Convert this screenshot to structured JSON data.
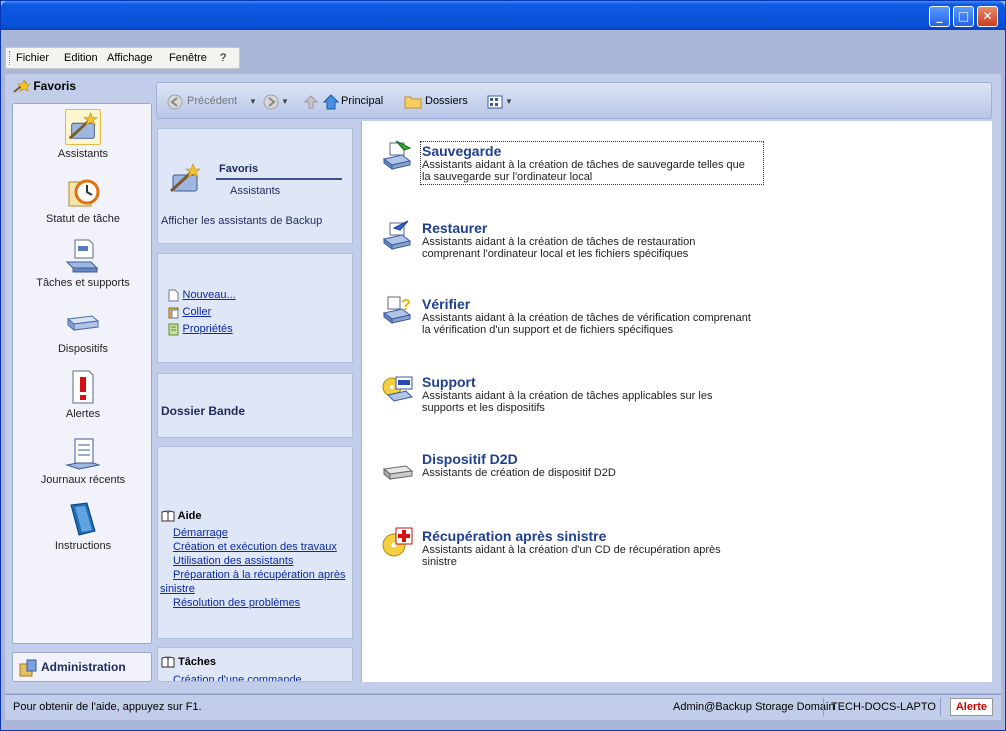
{
  "menubar": {
    "items": [
      "Fichier",
      "Edition",
      "Affichage",
      "Fenêtre",
      "?"
    ]
  },
  "sidebar": {
    "header": "Favoris",
    "items": [
      {
        "label": "Assistants",
        "icon": "wizard-icon"
      },
      {
        "label": "Statut de tâche",
        "icon": "task-status-icon"
      },
      {
        "label": "Tâches et supports",
        "icon": "tasks-media-icon"
      },
      {
        "label": "Dispositifs",
        "icon": "devices-icon"
      },
      {
        "label": "Alertes",
        "icon": "alerts-icon"
      },
      {
        "label": "Journaux récents",
        "icon": "logs-icon"
      },
      {
        "label": "Instructions",
        "icon": "instructions-icon"
      }
    ],
    "admin_label": "Administration"
  },
  "toolbar": {
    "back": "Précédent",
    "home": "Principal",
    "folders": "Dossiers"
  },
  "middle": {
    "favoris_title": "Favoris",
    "favoris_sub": "Assistants",
    "favoris_desc": "Afficher les assistants de Backup",
    "actions": [
      "Nouveau...",
      "Coller",
      "Propriétés"
    ],
    "dossier": "Dossier Bande",
    "aide_title": "Aide",
    "aide_links": [
      "Démarrage",
      "Création et exécution des travaux",
      "Utilisation des assistants",
      "Préparation à la récupération après",
      "sinistre",
      "Résolution des problèmes"
    ],
    "taches_title": "Tâches",
    "taches_link": "Création d'une commande"
  },
  "tasks": [
    {
      "title": "Sauvegarde",
      "desc1": "Assistants aidant à la création de tâches de sauvegarde telles que",
      "desc2": "la sauvegarde sur l'ordinateur local"
    },
    {
      "title": "Restaurer",
      "desc1": "Assistants aidant à la création de tâches de restauration",
      "desc2": "comprenant l'ordinateur local et les fichiers spécifiques"
    },
    {
      "title": "Vérifier",
      "desc1": "Assistants aidant à la création de tâches de vérification comprenant",
      "desc2": "la vérification d'un support et de fichiers spécifiques"
    },
    {
      "title": "Support",
      "desc1": "Assistants aidant à la création de tâches applicables sur les",
      "desc2": "supports et les dispositifs"
    },
    {
      "title": "Dispositif D2D",
      "desc1": "Assistants de création de dispositif D2D",
      "desc2": ""
    },
    {
      "title": "Récupération après sinistre",
      "desc1": "Assistants aidant à la création d'un CD de récupération après",
      "desc2": "sinistre"
    }
  ],
  "status": {
    "help": "Pour obtenir de l'aide, appuyez sur F1.",
    "user": "Admin@Backup Storage Domain",
    "machine": "TECH-DOCS-LAPTO",
    "alert": "Alerte"
  }
}
